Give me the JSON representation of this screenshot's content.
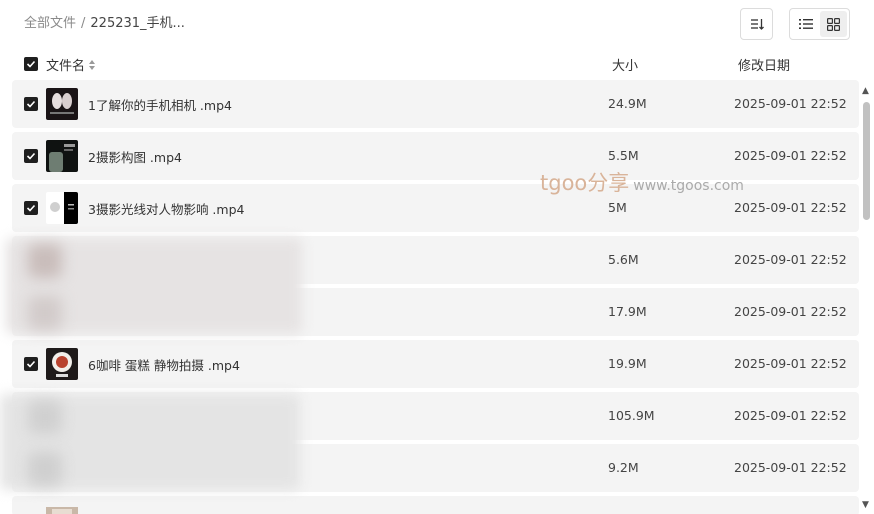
{
  "breadcrumb": {
    "root": "全部文件",
    "separator": "/",
    "current": "225231_手机..."
  },
  "toolbar": {
    "sort_icon": "sort-descending-icon",
    "list_view_icon": "list-view-icon",
    "grid_view_icon": "grid-view-icon"
  },
  "table_header": {
    "name": "文件名",
    "size": "大小",
    "date": "修改日期"
  },
  "files": [
    {
      "name": "1了解你的手机相机 .mp4",
      "size": "24.9M",
      "date": "2025-09-01 22:52",
      "checked": true
    },
    {
      "name": "2摄影构图 .mp4",
      "size": "5.5M",
      "date": "2025-09-01 22:52",
      "checked": true
    },
    {
      "name": "3摄影光线对人物影响 .mp4",
      "size": "5M",
      "date": "2025-09-01 22:52",
      "checked": true
    },
    {
      "name": "",
      "size": "5.6M",
      "date": "2025-09-01 22:52",
      "checked": true
    },
    {
      "name": "",
      "size": "17.9M",
      "date": "2025-09-01 22:52",
      "checked": true
    },
    {
      "name": "6咖啡 蛋糕 静物拍摄 .mp4",
      "size": "19.9M",
      "date": "2025-09-01 22:52",
      "checked": true
    },
    {
      "name": "",
      "size": "105.9M",
      "date": "2025-09-01 22:52",
      "checked": true
    },
    {
      "name": "",
      "size": "9.2M",
      "date": "2025-09-01 22:52",
      "checked": true
    }
  ],
  "watermark": {
    "brand": "tgoo分享",
    "url": "www.tgoos.com"
  }
}
